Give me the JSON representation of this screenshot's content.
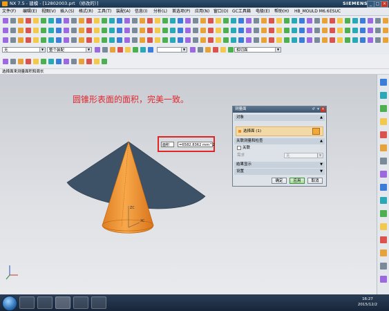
{
  "app": {
    "title": "NX 7.5 - 建模 - [12802003.prt （修改的）]",
    "brand": "SIEMENS"
  },
  "menu": [
    "文件(F)",
    "编辑(E)",
    "视图(V)",
    "插入(S)",
    "格式(R)",
    "工具(T)",
    "装配(A)",
    "信息(I)",
    "分析(L)",
    "首选项(P)",
    "应用(N)",
    "窗口(O)",
    "GC工具箱",
    "电极(E)",
    "帮助(H)",
    "HB_MOULD M6.6",
    "ESUC"
  ],
  "toolbar": {
    "filter_value": "无",
    "scope_value": "整个装配",
    "snap_value": "相切面"
  },
  "status_prompt": "选择面来测量面积和周长",
  "annotation": "圆锥形表面的面积，完美一致。",
  "measure": {
    "type": "面积",
    "value": "=6582.8362 mm^2"
  },
  "dialog": {
    "title": "测量面",
    "section_object": "对象",
    "select_face": "选择面 (1)",
    "section_assoc": "关联测量和检查",
    "assoc_checkbox": "关联",
    "requirement_label": "需求",
    "requirement_value": "无",
    "section_results": "结果显示",
    "section_settings": "设置",
    "ok": "确定",
    "apply": "应用",
    "cancel": "取消"
  },
  "axis_labels": {
    "zc": "ZC",
    "xc": "XC"
  },
  "taskbar": {
    "time": "16:27",
    "date": "2015/12/2"
  },
  "colors": {
    "cone": "#f39a3b",
    "sector": "#3d5266",
    "annotation": "#e0282e",
    "highlight": "#e02424"
  }
}
